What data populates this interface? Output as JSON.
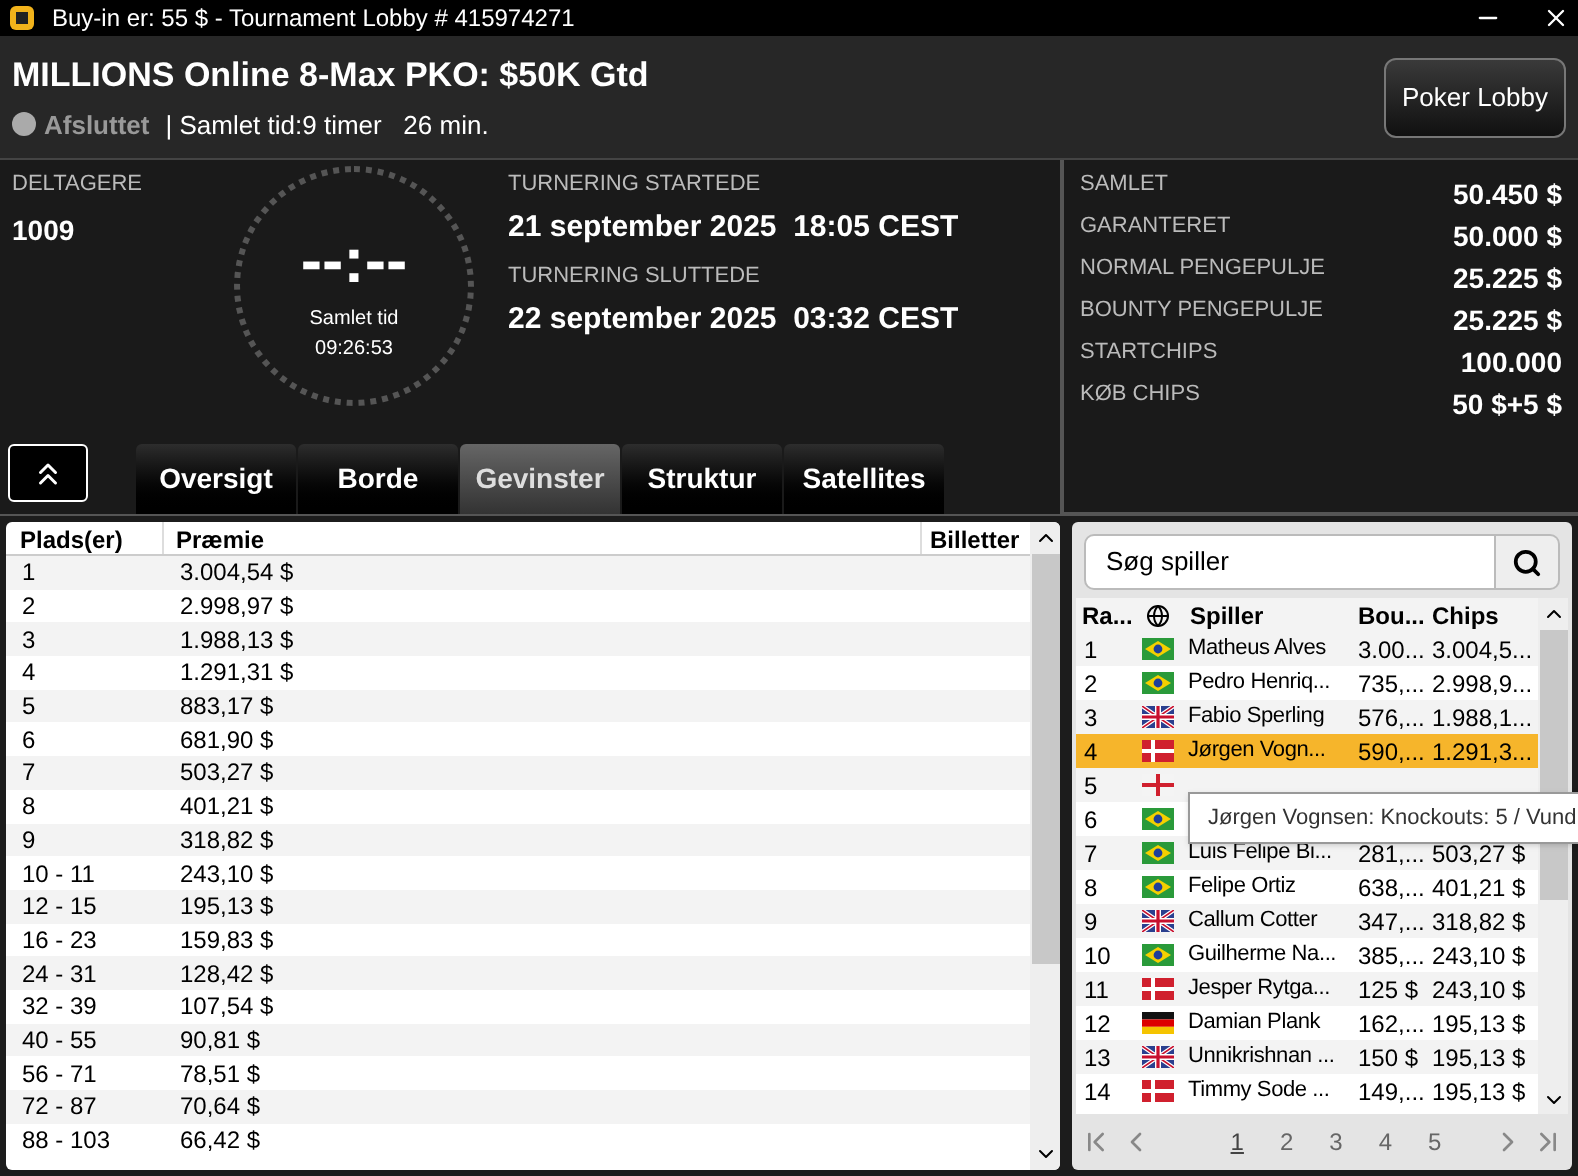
{
  "window": {
    "title": "Buy-in er: 55 $ - Tournament Lobby # 415974271"
  },
  "header": {
    "tournament_name": "MILLIONS Online 8-Max PKO: $50K Gtd",
    "status": "Afsluttet",
    "status_detail": "| Samlet tid:9 timer   26 min.",
    "lobby_button": "Poker Lobby"
  },
  "entrants": {
    "label": "DELTAGERE",
    "value": "1009"
  },
  "clock": {
    "display": "--:--",
    "label": "Samlet tid",
    "elapsed": "09:26:53"
  },
  "times": [
    {
      "label": "TURNERING STARTEDE",
      "value": "21 september 2025  18:05 CEST"
    },
    {
      "label": "TURNERING SLUTTEDE",
      "value": "22 september 2025  03:32 CEST"
    }
  ],
  "stats": [
    {
      "label": "SAMLET",
      "value": "50.450 $"
    },
    {
      "label": "GARANTERET",
      "value": "50.000 $"
    },
    {
      "label": "NORMAL PENGEPULJE",
      "value": "25.225 $"
    },
    {
      "label": "BOUNTY PENGEPULJE",
      "value": "25.225 $"
    },
    {
      "label": "STARTCHIPS",
      "value": "100.000"
    },
    {
      "label": "KØB CHIPS",
      "value": "50 $+5 $"
    }
  ],
  "tabs": [
    {
      "label": "Oversigt",
      "selected": false
    },
    {
      "label": "Borde",
      "selected": false
    },
    {
      "label": "Gevinster",
      "selected": true
    },
    {
      "label": "Struktur",
      "selected": false
    },
    {
      "label": "Satellites",
      "selected": false
    }
  ],
  "prizes": {
    "columns": [
      "Plads(er)",
      "Præmie",
      "Billetter"
    ],
    "rows": [
      [
        "1",
        "3.004,54 $"
      ],
      [
        "2",
        "2.998,97 $"
      ],
      [
        "3",
        "1.988,13 $"
      ],
      [
        "4",
        "1.291,31 $"
      ],
      [
        "5",
        "883,17 $"
      ],
      [
        "6",
        "681,90 $"
      ],
      [
        "7",
        "503,27 $"
      ],
      [
        "8",
        "401,21 $"
      ],
      [
        "9",
        "318,82 $"
      ],
      [
        "10 - 11",
        "243,10 $"
      ],
      [
        "12 - 15",
        "195,13 $"
      ],
      [
        "16 - 23",
        "159,83 $"
      ],
      [
        "24 - 31",
        "128,42 $"
      ],
      [
        "32 - 39",
        "107,54 $"
      ],
      [
        "40 - 55",
        "90,81 $"
      ],
      [
        "56 - 71",
        "78,51 $"
      ],
      [
        "72 - 87",
        "70,64 $"
      ],
      [
        "88 - 103",
        "66,42 $"
      ]
    ]
  },
  "players": {
    "search": {
      "placeholder": "Søg spiller"
    },
    "columns": [
      "Ra...",
      "Spiller",
      "Bou...",
      "Chips"
    ],
    "rows": [
      {
        "rank": "1",
        "flag": {
          "kind": "br"
        },
        "name": "Matheus Alves",
        "bounty": "3.00...",
        "chips": "3.004,5...",
        "selected": false
      },
      {
        "rank": "2",
        "flag": {
          "kind": "br"
        },
        "name": "Pedro Henriq...",
        "bounty": "735,...",
        "chips": "2.998,9...",
        "selected": false
      },
      {
        "rank": "3",
        "flag": {
          "kind": "gb"
        },
        "name": "Fabio Sperling",
        "bounty": "576,...",
        "chips": "1.988,1...",
        "selected": false
      },
      {
        "rank": "4",
        "flag": {
          "kind": "dk"
        },
        "name": "Jørgen Vogn...",
        "bounty": "590,...",
        "chips": "1.291,3...",
        "selected": true
      },
      {
        "rank": "5",
        "flag": {
          "kind": "en"
        },
        "selected": false
      },
      {
        "rank": "6",
        "flag": {
          "kind": "br"
        },
        "selected": false
      },
      {
        "rank": "7",
        "flag": {
          "kind": "br"
        },
        "name": "Luis Felipe Bi...",
        "bounty": "281,...",
        "chips": "503,27 $",
        "selected": false
      },
      {
        "rank": "8",
        "flag": {
          "kind": "br"
        },
        "name": "Felipe Ortiz",
        "bounty": "638,...",
        "chips": "401,21 $",
        "selected": false
      },
      {
        "rank": "9",
        "flag": {
          "kind": "gb"
        },
        "name": "Callum Cotter",
        "bounty": "347,...",
        "chips": "318,82 $",
        "selected": false
      },
      {
        "rank": "10",
        "flag": {
          "kind": "br"
        },
        "name": "Guilherme Na...",
        "bounty": "385,...",
        "chips": "243,10 $",
        "selected": false
      },
      {
        "rank": "11",
        "flag": {
          "kind": "dk"
        },
        "name": "Jesper Rytga...",
        "bounty": "125 $",
        "chips": "243,10 $",
        "selected": false
      },
      {
        "rank": "12",
        "flag": {
          "kind": "de"
        },
        "name": "Damian Plank",
        "bounty": "162,...",
        "chips": "195,13 $",
        "selected": false
      },
      {
        "rank": "13",
        "flag": {
          "kind": "gb"
        },
        "name": "Unnikrishnan ...",
        "bounty": "150 $",
        "chips": "195,13 $",
        "selected": false
      },
      {
        "rank": "14",
        "flag": {
          "kind": "dk"
        },
        "name": "Timmy Sode ...",
        "bounty": "149,...",
        "chips": "195,13 $",
        "selected": false
      }
    ],
    "tooltip": "Jørgen Vognsen: Knockouts: 5 / Vund",
    "pages": [
      {
        "label": "1",
        "selected": true
      },
      {
        "label": "2",
        "selected": false
      },
      {
        "label": "3",
        "selected": false
      },
      {
        "label": "4",
        "selected": false
      },
      {
        "label": "5",
        "selected": false
      }
    ]
  }
}
